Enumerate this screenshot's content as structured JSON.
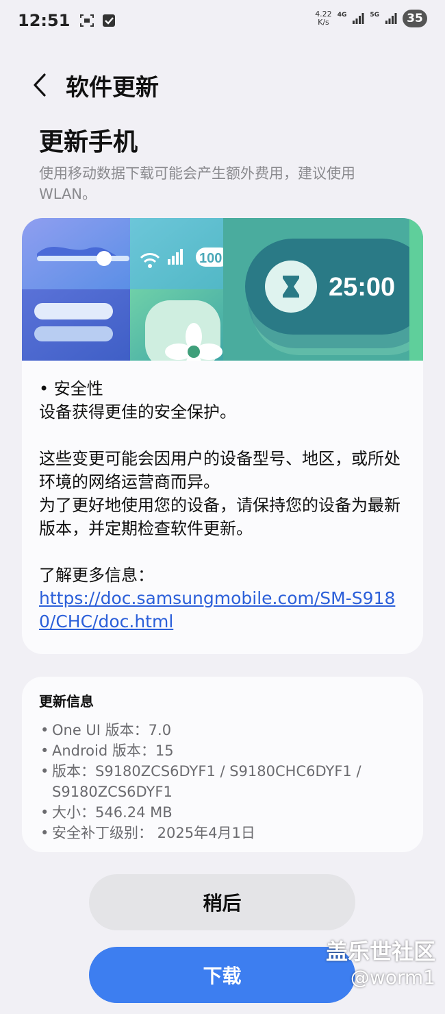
{
  "status_bar": {
    "time": "12:51",
    "speed_value": "4.22",
    "speed_unit": "K/s",
    "net1": "4G",
    "net2": "5G",
    "battery": "35"
  },
  "header": {
    "title": "软件更新"
  },
  "page": {
    "title": "更新手机",
    "note": "使用移动数据下载可能会产生额外费用，建议使用WLAN。"
  },
  "banner": {
    "timer": "25:00",
    "battery_text": "100"
  },
  "changelog": {
    "bullet": "• 安全性",
    "bullet_desc": "设备获得更佳的安全保护。",
    "para1": "这些变更可能会因用户的设备型号、地区，或所处环境的网络运营商而异。",
    "para2": "为了更好地使用您的设备，请保持您的设备为最新版本，并定期检查软件更新。",
    "more_label": "了解更多信息：",
    "link": "https://doc.samsungmobile.com/SM-S9180/CHC/doc.html"
  },
  "info": {
    "title": "更新信息",
    "one_ui": "One UI 版本：7.0",
    "android": "Android 版本：15",
    "version_line1": "版本：S9180ZCS6DYF1 / S9180CHC6DYF1 /",
    "version_line2": "S9180ZCS6DYF1",
    "size": "大小：546.24 MB",
    "patch": "安全补丁级别： 2025年4月1日"
  },
  "buttons": {
    "later": "稍后",
    "download": "下载"
  },
  "watermark": {
    "line1": "盖乐世社区",
    "line2": "@worm1"
  },
  "colors": {
    "accent": "#3d7ef0",
    "link": "#2b5fd9",
    "background": "#f1f0f5"
  }
}
